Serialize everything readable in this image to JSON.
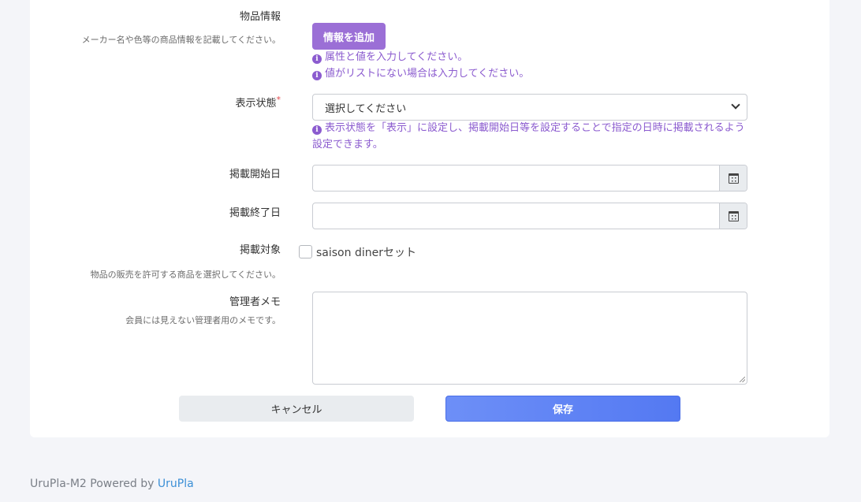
{
  "form": {
    "product_info": {
      "label": "物品情報",
      "description": "メーカー名や色等の商品情報を記載してください。",
      "add_button": "情報を追加",
      "hints": [
        "属性と値を入力してください。",
        "値がリストにない場合は入力してください。"
      ]
    },
    "display_status": {
      "label": "表示状態",
      "required_mark": "*",
      "selected": "選択してください",
      "hint": "表示状態を「表示」に設定し、掲載開始日等を設定することで指定の日時に掲載されるよう設定できます。"
    },
    "start_date": {
      "label": "掲載開始日",
      "value": ""
    },
    "end_date": {
      "label": "掲載終了日",
      "value": ""
    },
    "target": {
      "label": "掲載対象",
      "description": "物品の販売を許可する商品を選択してください。",
      "option_label": "saison dinerセット",
      "checked": false
    },
    "admin_memo": {
      "label": "管理者メモ",
      "description": "会員には見えない管理者用のメモです。",
      "value": ""
    },
    "actions": {
      "cancel_label": "キャンセル",
      "save_label": "保存"
    }
  },
  "footer": {
    "prefix": "UruPla-M2 Powered by ",
    "link": "UruPla"
  },
  "colors": {
    "accent_purple": "#9b6fd6",
    "hint_purple": "#8b5bcf",
    "save_blue": "#5479f2",
    "link_blue": "#3b8fd6"
  }
}
